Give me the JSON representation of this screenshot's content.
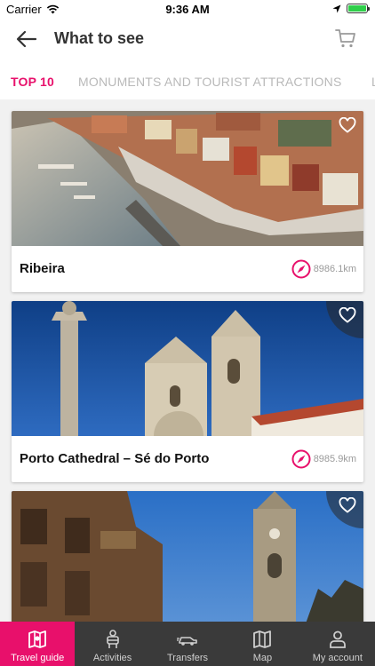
{
  "status": {
    "carrier": "Carrier",
    "time": "9:36 AM"
  },
  "header": {
    "title": "What to see"
  },
  "tabs": [
    {
      "label": "TOP 10",
      "active": true
    },
    {
      "label": "MONUMENTS AND TOURIST ATTRACTIONS",
      "active": false
    }
  ],
  "cards": [
    {
      "title": "Ribeira",
      "distance": "8986.1km",
      "icon": "compass-icon"
    },
    {
      "title": "Porto Cathedral – Sé do Porto",
      "distance": "8985.9km",
      "icon": "compass-icon"
    },
    {
      "title": "",
      "distance": "",
      "icon": "compass-icon"
    }
  ],
  "nav": [
    {
      "label": "Travel guide",
      "icon": "map-guide-icon",
      "active": true
    },
    {
      "label": "Activities",
      "icon": "activities-icon",
      "active": false
    },
    {
      "label": "Transfers",
      "icon": "car-icon",
      "active": false
    },
    {
      "label": "Map",
      "icon": "map-icon",
      "active": false
    },
    {
      "label": "My account",
      "icon": "user-icon",
      "active": false
    }
  ],
  "colors": {
    "accent": "#e8106b",
    "nav_background": "#3a3a3a",
    "inactive_tab": "#b9b9b9"
  }
}
